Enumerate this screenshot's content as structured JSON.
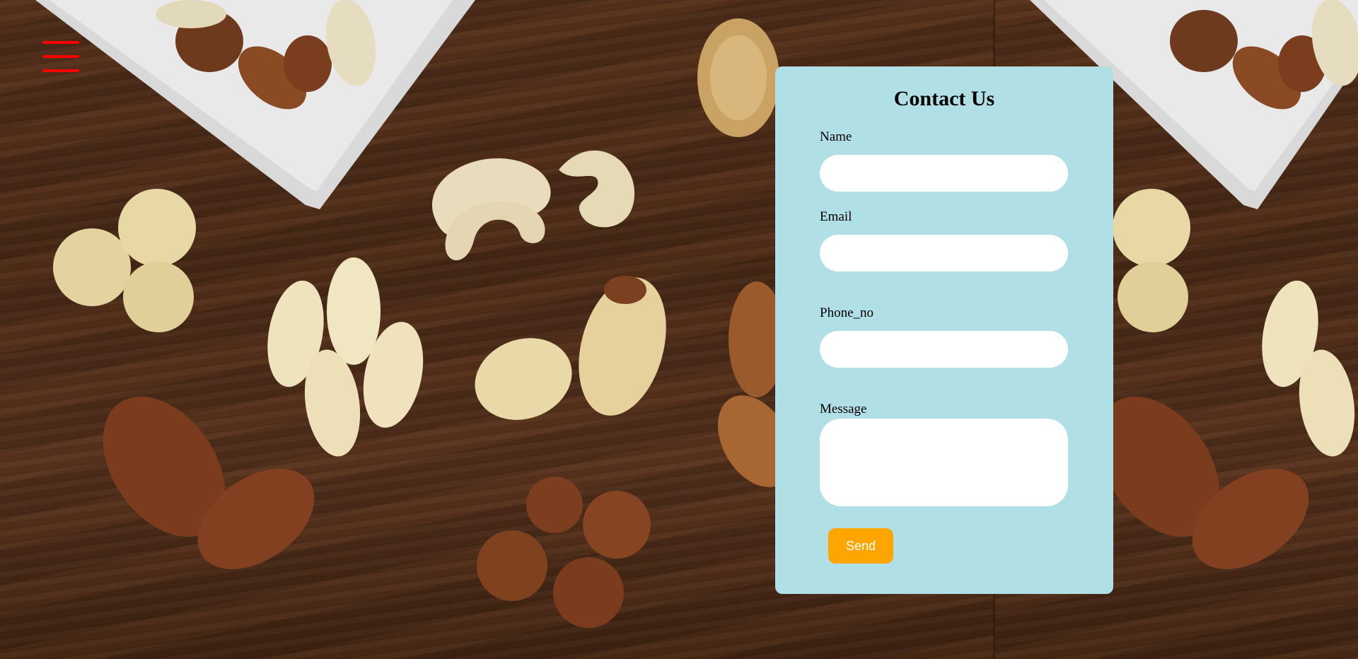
{
  "nav": {
    "menu_icon": "hamburger-menu-icon",
    "menu_color": "#ff0000"
  },
  "contact": {
    "title": "Contact Us",
    "fields": {
      "name": {
        "label": "Name",
        "value": "",
        "placeholder": ""
      },
      "email": {
        "label": "Email",
        "value": "",
        "placeholder": ""
      },
      "phone": {
        "label": "Phone_no",
        "value": "",
        "placeholder": ""
      },
      "message": {
        "label": "Message",
        "value": "",
        "placeholder": ""
      }
    },
    "send_label": "Send",
    "card_color": "#b0dfe6",
    "button_color": "#ffa500"
  }
}
